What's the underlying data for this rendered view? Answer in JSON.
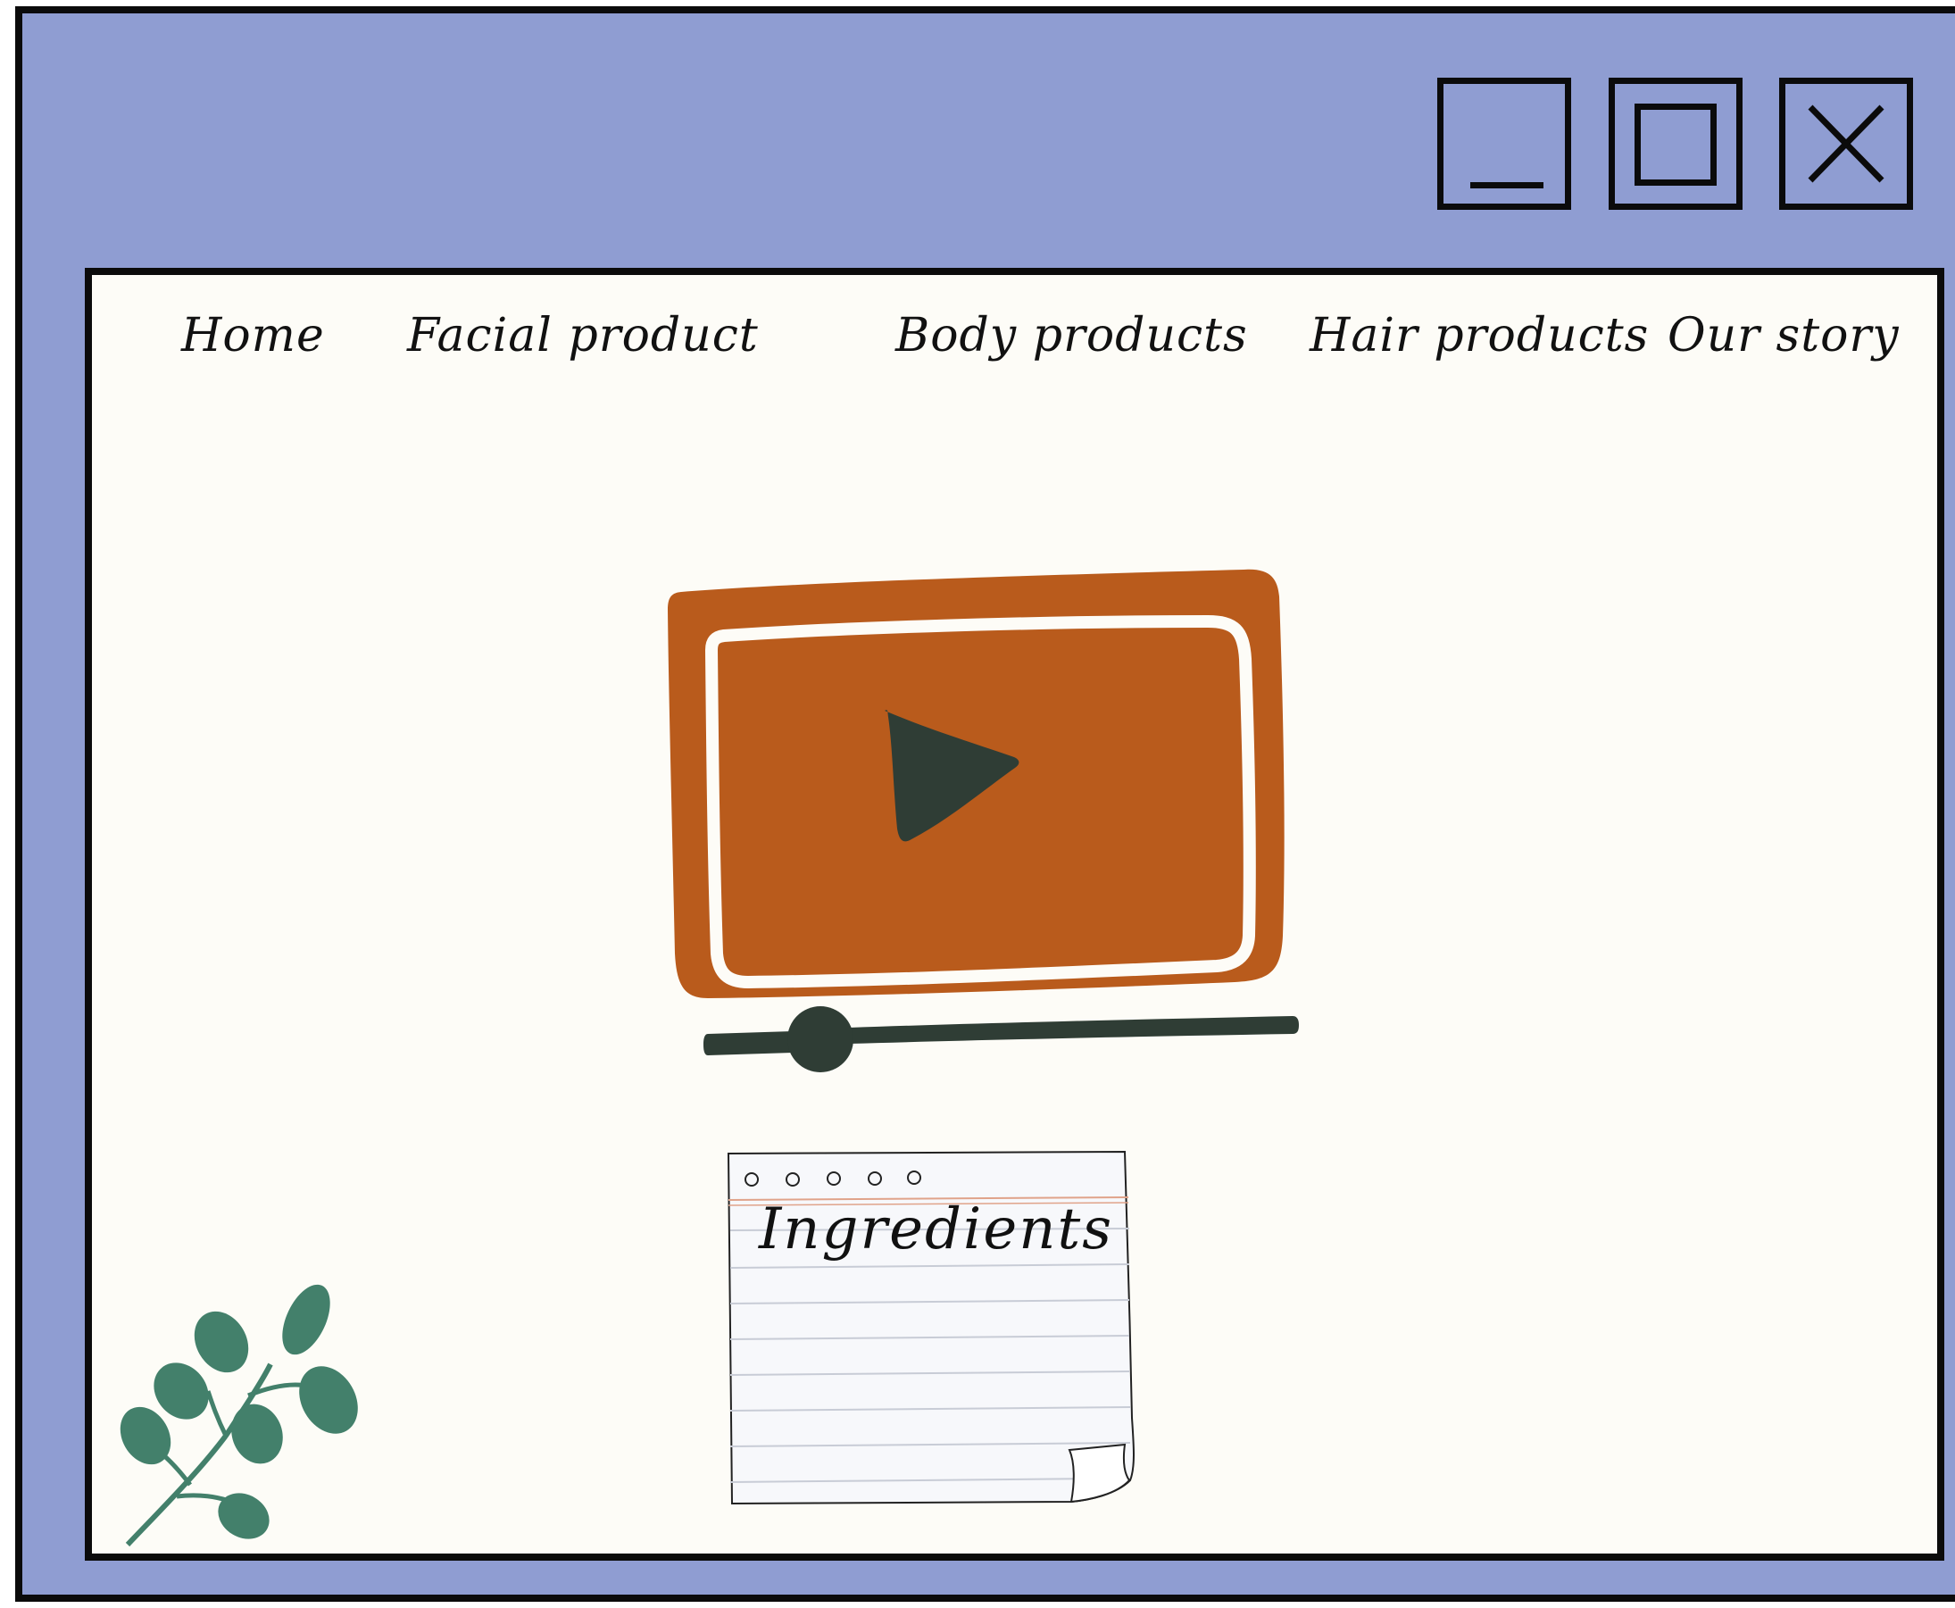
{
  "window": {
    "background_color": "#8f9dd2",
    "controls": [
      "minimize-icon",
      "maximize-icon",
      "close-icon"
    ]
  },
  "nav": {
    "items": [
      {
        "label": "Home"
      },
      {
        "label": "Facial product"
      },
      {
        "label": "Body products"
      },
      {
        "label": "Hair products"
      },
      {
        "label": "Our story"
      }
    ]
  },
  "video": {
    "icon": "play-icon",
    "frame_color": "#b95b1c",
    "progress_fraction": 0.26
  },
  "note": {
    "title": "Ingredients"
  },
  "decoration": {
    "icon": "leaf-branch-icon",
    "color": "#43806b"
  }
}
